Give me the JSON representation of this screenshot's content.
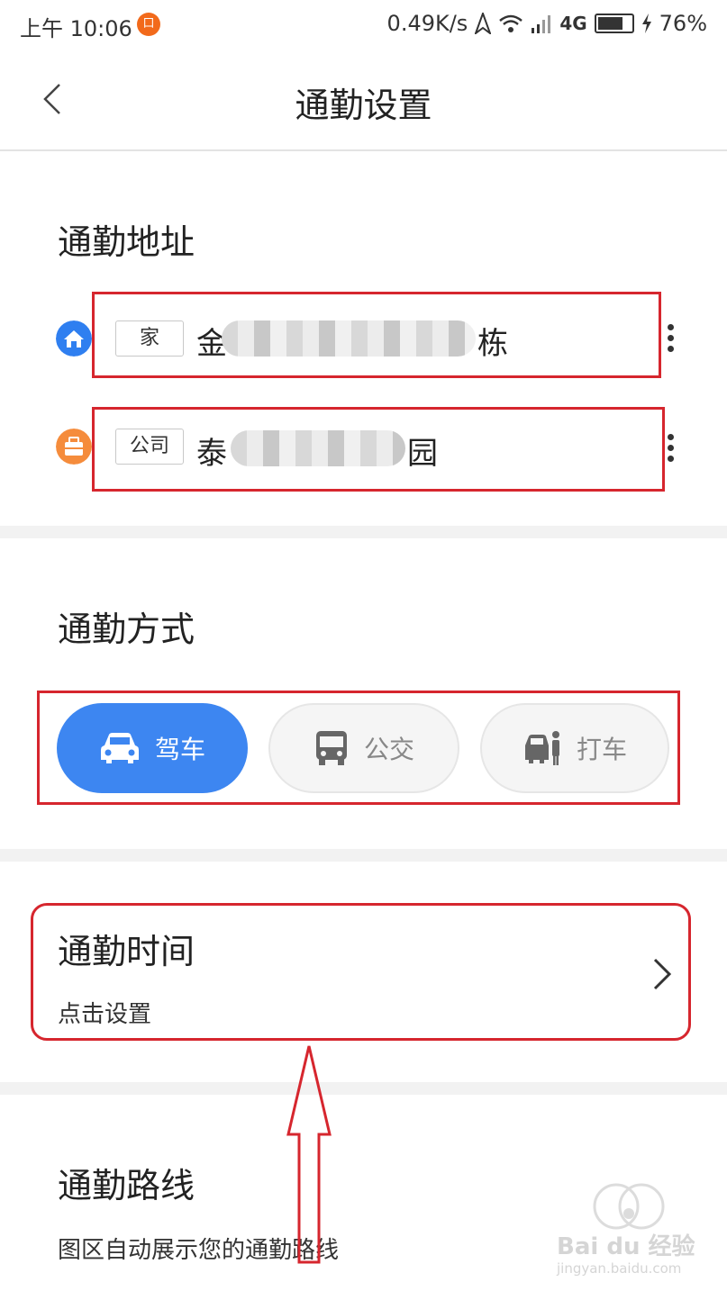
{
  "status_bar": {
    "time": "上午 10:06",
    "notification_badge": "口",
    "network_speed": "0.49K/s",
    "network_type": "4G",
    "battery_percent": "76%",
    "battery_level": 0.76
  },
  "nav": {
    "title": "通勤设置",
    "back_icon": "chevron-left-icon"
  },
  "commute_address": {
    "title": "通勤地址",
    "home": {
      "tag": "家",
      "address_start": "金",
      "address_end": "栋",
      "icon": "home-icon",
      "icon_color": "#2f7ff0"
    },
    "company": {
      "tag": "公司",
      "address_start": "泰",
      "address_end": "园",
      "icon": "briefcase-icon",
      "icon_color": "#f58c3c"
    }
  },
  "commute_mode": {
    "title": "通勤方式",
    "options": [
      {
        "label": "驾车",
        "icon": "car-icon",
        "selected": true
      },
      {
        "label": "公交",
        "icon": "bus-icon",
        "selected": false
      },
      {
        "label": "打车",
        "icon": "taxi-icon",
        "selected": false
      }
    ],
    "accent_color": "#3d86f1"
  },
  "commute_time": {
    "title": "通勤时间",
    "subtitle": "点击设置"
  },
  "commute_route": {
    "title": "通勤路线",
    "subtitle": "图区自动展示您的通勤路线"
  },
  "watermark": {
    "logo": "Bai du 经验",
    "url": "jingyan.baidu.com"
  },
  "annotation_color": "#d6262e"
}
